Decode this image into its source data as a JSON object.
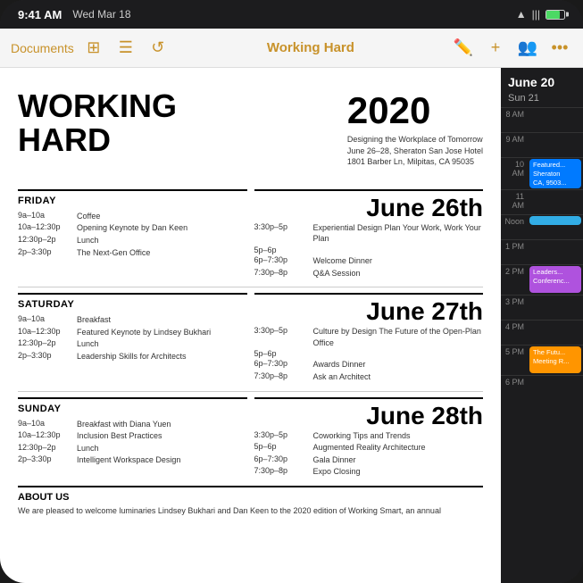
{
  "statusBar": {
    "time": "9:41 AM",
    "date": "Wed Mar 18"
  },
  "toolbar": {
    "docsLabel": "Documents",
    "title": "Working Hard",
    "icons": [
      "layout-icon",
      "list-icon",
      "history-icon",
      "collab-icon",
      "add-icon",
      "share-icon",
      "more-icon"
    ]
  },
  "document": {
    "mainTitle": "WORKING HARD",
    "year": "2020",
    "subtitle": "Designing the Workplace of Tomorrow\nJune 26–28, Sheraton San Jose Hotel\n1801 Barber Ln, Milpitas, CA 95035",
    "days": [
      {
        "name": "FRIDAY",
        "bigDate": "June 26th",
        "leftSchedule": [
          {
            "time": "9a–10a",
            "event": "Coffee"
          },
          {
            "time": "10a–12:30p",
            "event": "Opening Keynote by Dan Keen"
          },
          {
            "time": "12:30p–2p",
            "event": "Lunch"
          },
          {
            "time": "2p–3:30p",
            "event": "The Next-Gen Office"
          }
        ],
        "rightSchedule": [
          {
            "time": "3:30p–5p",
            "event": "Experiential Design Plan Your Work, Work Your Plan"
          },
          {
            "time": "5p–6p",
            "event": ""
          },
          {
            "time": "6p–7:30p",
            "event": "Welcome Dinner"
          },
          {
            "time": "7:30p–8p",
            "event": "Q&A Session"
          }
        ]
      },
      {
        "name": "SATURDAY",
        "bigDate": "June 27th",
        "leftSchedule": [
          {
            "time": "9a–10a",
            "event": "Breakfast"
          },
          {
            "time": "10a–12:30p",
            "event": "Featured Keynote by Lindsey Bukhari"
          },
          {
            "time": "12:30p–2p",
            "event": "Lunch"
          },
          {
            "time": "2p–3:30p",
            "event": "Leadership Skills for Architects"
          }
        ],
        "rightSchedule": [
          {
            "time": "3:30p–5p",
            "event": "Culture by Design The Future of the Open-Plan Office"
          },
          {
            "time": "5p–6p",
            "event": ""
          },
          {
            "time": "6p–7:30p",
            "event": "Awards Dinner"
          },
          {
            "time": "7:30p–8p",
            "event": "Ask an Architect"
          }
        ]
      },
      {
        "name": "SUNDAY",
        "bigDate": "June 28th",
        "leftSchedule": [
          {
            "time": "9a–10a",
            "event": "Breakfast with Diana Yuen"
          },
          {
            "time": "10a–12:30p",
            "event": "Inclusion Best Practices"
          },
          {
            "time": "12:30p–2p",
            "event": "Lunch"
          },
          {
            "time": "2p–3:30p",
            "event": "Intelligent Workspace Design"
          }
        ],
        "rightSchedule": [
          {
            "time": "3:30p–5p",
            "event": "Coworking Tips and Trends"
          },
          {
            "time": "5p–6p",
            "event": "Augmented Reality Architecture"
          },
          {
            "time": "6p–7:30p",
            "event": "Gala Dinner"
          },
          {
            "time": "7:30p–8p",
            "event": "Expo Closing"
          }
        ]
      }
    ],
    "about": {
      "label": "ABOUT US",
      "text": "We are pleased to welcome luminaries Lindsey Bukhari and Dan Keen to the 2020 edition of Working Smart, an annual"
    }
  },
  "calendar": {
    "month": "June 20",
    "dayLabel": "Sun 21",
    "times": [
      {
        "label": "8 AM",
        "event": null
      },
      {
        "label": "9 AM",
        "event": null
      },
      {
        "label": "10 AM",
        "event": {
          "text": "Feature... Sheraton CA, 9503...",
          "color": "blue"
        }
      },
      {
        "label": "11 AM",
        "event": null
      },
      {
        "label": "Noon",
        "event": {
          "text": "",
          "color": "cyan"
        }
      },
      {
        "label": "1 PM",
        "event": null
      },
      {
        "label": "2 PM",
        "event": {
          "text": "Leaders... Conferenc...",
          "color": "purple"
        }
      },
      {
        "label": "3 PM",
        "event": null
      },
      {
        "label": "4 PM",
        "event": null
      },
      {
        "label": "5 PM",
        "event": {
          "text": "The Futu... Meeting R...",
          "color": "orange"
        }
      },
      {
        "label": "6 PM",
        "event": null
      }
    ]
  }
}
